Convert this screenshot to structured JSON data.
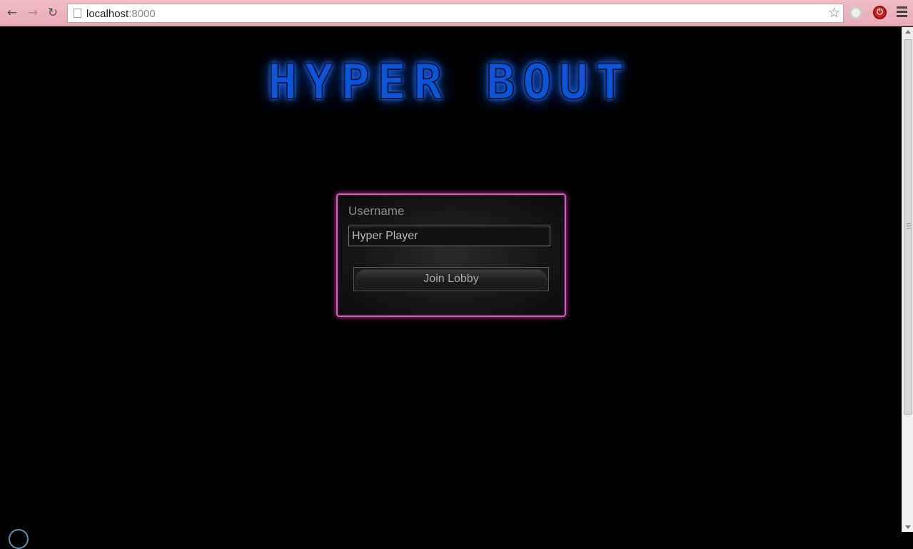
{
  "browser": {
    "url_host": "localhost",
    "url_port": ":8000"
  },
  "logo": {
    "text": "HYPER BOUT"
  },
  "login": {
    "username_label": "Username",
    "username_value": "Hyper Player",
    "join_button_label": "Join Lobby"
  },
  "colors": {
    "panel_border": "#cf5fb8",
    "logo_blue": "#1466ff"
  }
}
